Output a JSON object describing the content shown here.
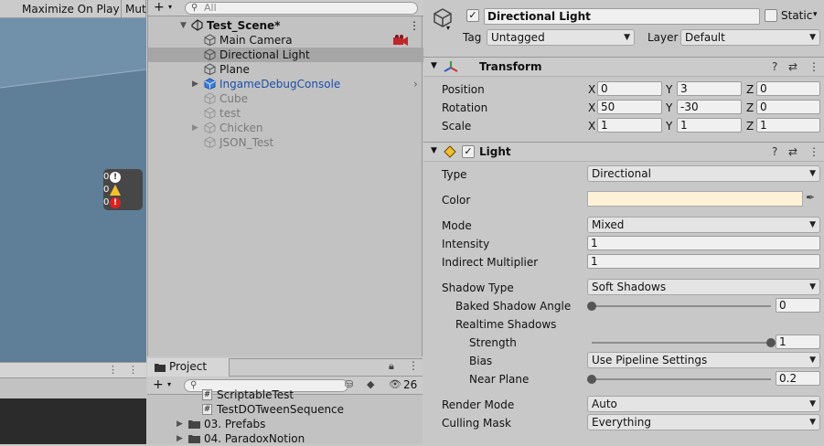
{
  "game": {
    "toolbar": {
      "maximize_label": "Maximize On Play",
      "mute_label": "Mut"
    },
    "debug_counts": {
      "info": "0",
      "warning": "0",
      "error": "0"
    }
  },
  "hierarchy": {
    "search_placeholder": "All",
    "scene_name": "Test_Scene*",
    "items": [
      {
        "label": "Main Camera"
      },
      {
        "label": "Directional Light"
      },
      {
        "label": "Plane"
      },
      {
        "label": "IngameDebugConsole"
      },
      {
        "label": "Cube"
      },
      {
        "label": "test"
      },
      {
        "label": "Chicken"
      },
      {
        "label": "JSON_Test"
      }
    ]
  },
  "project": {
    "tab_label": "Project",
    "hidden_count": "26",
    "items": [
      {
        "label": "ScriptableTest"
      },
      {
        "label": "TestDOTweenSequence"
      },
      {
        "label": "03. Prefabs"
      },
      {
        "label": "04. ParadoxNotion"
      }
    ]
  },
  "inspector": {
    "object_name": "Directional Light",
    "static_label": "Static",
    "tag_label": "Tag",
    "tag_value": "Untagged",
    "layer_label": "Layer",
    "layer_value": "Default",
    "transform": {
      "title": "Transform",
      "position_label": "Position",
      "rotation_label": "Rotation",
      "scale_label": "Scale",
      "position": {
        "x": "0",
        "y": "3",
        "z": "0"
      },
      "rotation": {
        "x": "50",
        "y": "-30",
        "z": "0"
      },
      "scale": {
        "x": "1",
        "y": "1",
        "z": "1"
      }
    },
    "axis": {
      "x": "X",
      "y": "Y",
      "z": "Z"
    },
    "light": {
      "title": "Light",
      "type_label": "Type",
      "type_value": "Directional",
      "color_label": "Color",
      "color_value": "#fdf2d7",
      "mode_label": "Mode",
      "mode_value": "Mixed",
      "intensity_label": "Intensity",
      "intensity_value": "1",
      "indirect_label": "Indirect Multiplier",
      "indirect_value": "1",
      "shadow_type_label": "Shadow Type",
      "shadow_type_value": "Soft Shadows",
      "baked_angle_label": "Baked Shadow Angle",
      "baked_angle_value": "0",
      "baked_angle_fraction": 0,
      "realtime_label": "Realtime Shadows",
      "strength_label": "Strength",
      "strength_value": "1",
      "strength_fraction": 1,
      "bias_label": "Bias",
      "bias_value": "Use Pipeline Settings",
      "near_plane_label": "Near Plane",
      "near_plane_value": "0.2",
      "near_plane_fraction": 0,
      "render_mode_label": "Render Mode",
      "render_mode_value": "Auto",
      "culling_label": "Culling Mask",
      "culling_value": "Everything"
    }
  }
}
